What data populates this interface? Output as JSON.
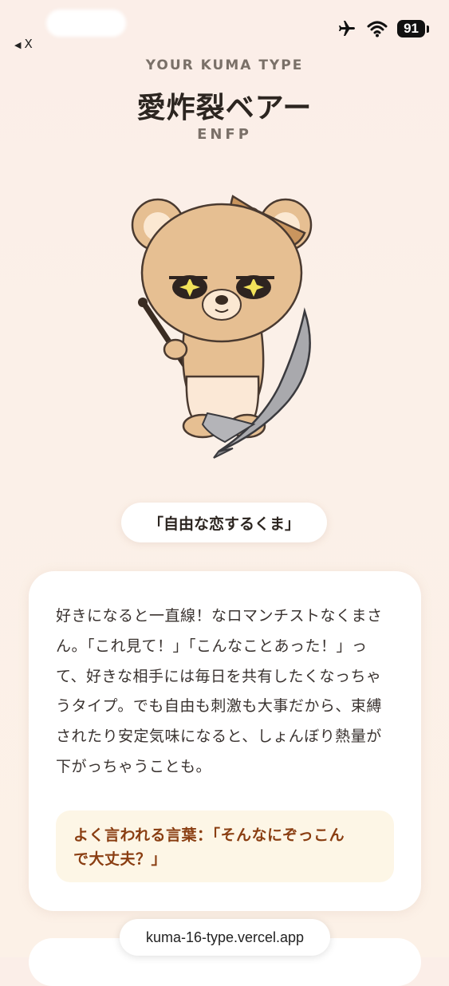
{
  "status_bar": {
    "back_label": "X",
    "battery_level": "91",
    "icons": [
      "airplane-icon",
      "wifi-icon",
      "battery-icon"
    ]
  },
  "header": {
    "eyebrow": "YOUR KUMA TYPE",
    "type_name": "愛炸裂ベアー",
    "type_code": "ENFP"
  },
  "nickname": "「自由な恋するくま」",
  "description": {
    "lines": [
      "好きになると一直線！なロマンチストなくまさ",
      "ん。「これ見て！」「こんなことあった！」っ",
      "て、好きな相手には毎日を共有したくなっちゃ",
      "うタイプ。でも自由も刺激も大事だから、束縛",
      "されたり安定気味になると、しょんぼり熱量が",
      "下がっちゃうことも。"
    ],
    "quote_lines": [
      "よく言われる言葉：「そんなにぞっこん",
      "で大丈夫？」"
    ]
  },
  "url_bar": {
    "url": "kuma-16-type.vercel.app"
  },
  "colors": {
    "background": "#fbeee8",
    "quote_background": "#fdf6e6",
    "quote_text": "#8a3e12",
    "bear_fur": "#e6bf92"
  }
}
